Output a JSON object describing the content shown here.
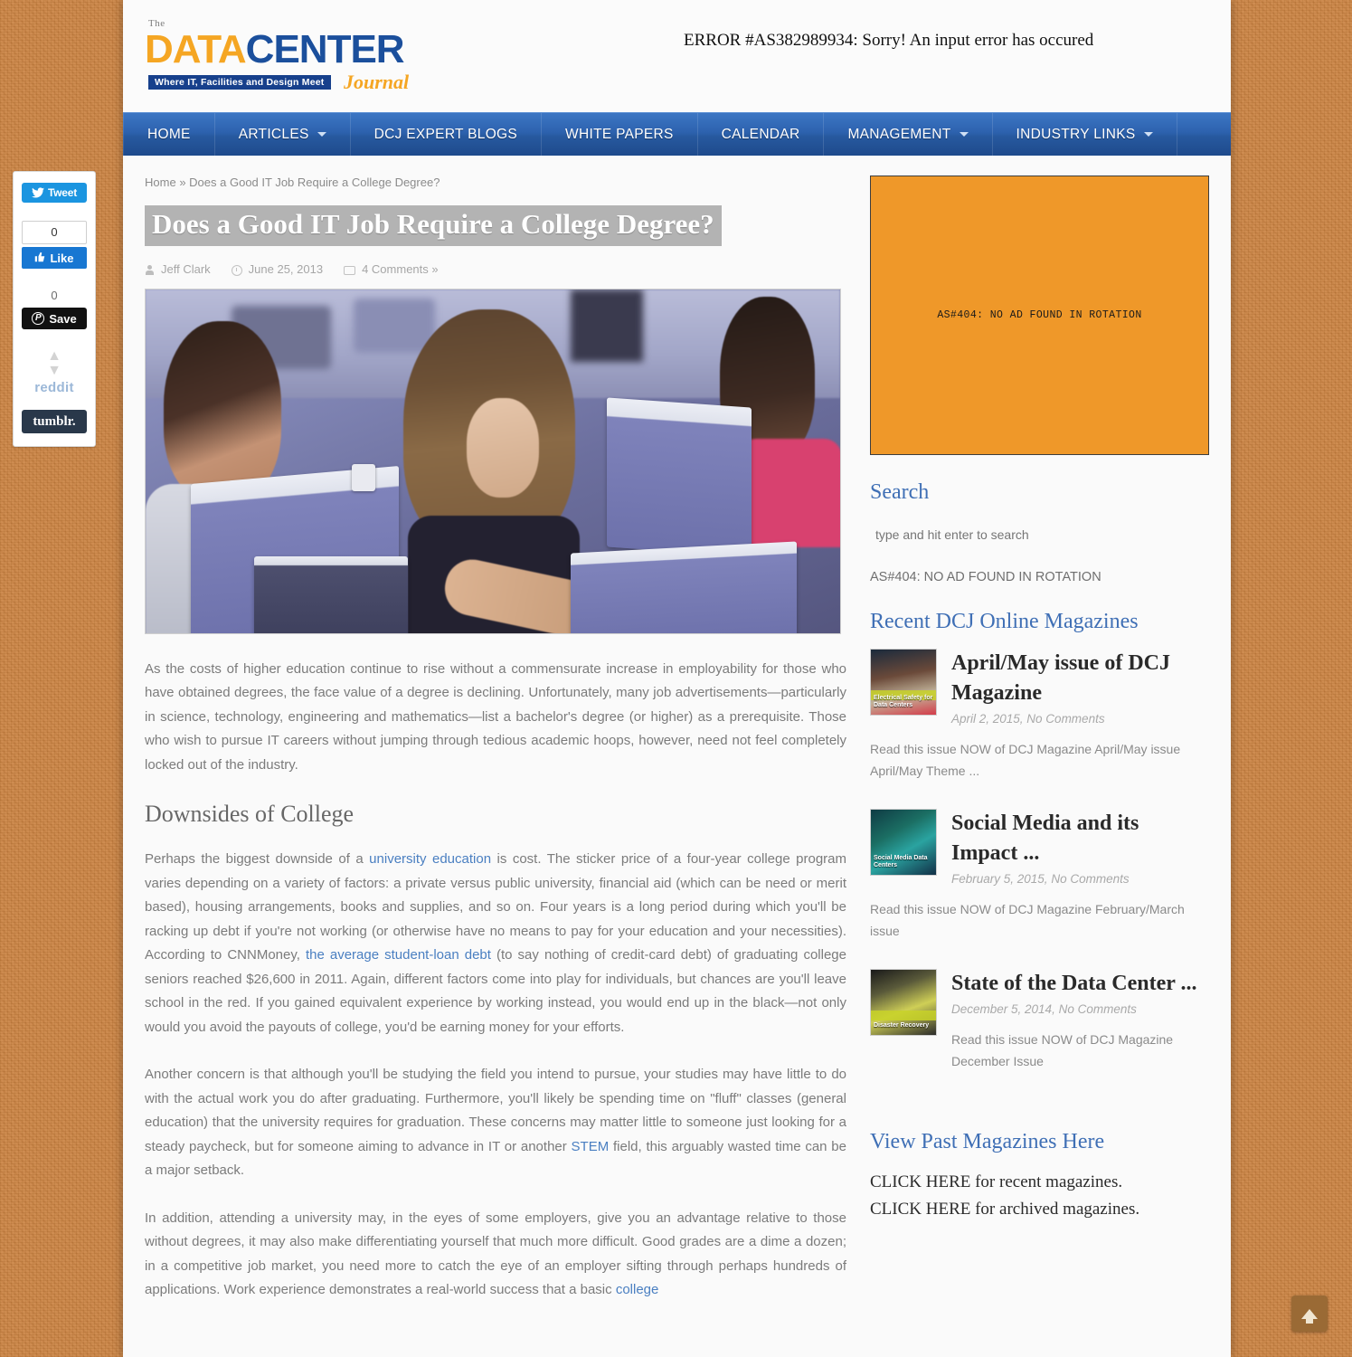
{
  "error_banner": "ERROR #AS382989934: Sorry! An input error has occured",
  "logo": {
    "the": "The",
    "data": "DATA",
    "center": "CENTER",
    "tagline": "Where IT, Facilities and Design Meet",
    "journal": "Journal"
  },
  "nav": {
    "items": [
      {
        "label": "HOME",
        "has_caret": false
      },
      {
        "label": "ARTICLES",
        "has_caret": true
      },
      {
        "label": "DCJ EXPERT BLOGS",
        "has_caret": false
      },
      {
        "label": "WHITE PAPERS",
        "has_caret": false
      },
      {
        "label": "CALENDAR",
        "has_caret": false
      },
      {
        "label": "MANAGEMENT",
        "has_caret": true
      },
      {
        "label": "INDUSTRY LINKS",
        "has_caret": true
      }
    ]
  },
  "breadcrumb": {
    "home": "Home",
    "separator": "»",
    "current": "Does a Good IT Job Require a College Degree?"
  },
  "post": {
    "title": "Does a Good IT Job Require a College Degree?",
    "author": "Jeff Clark",
    "date": "June 25, 2013",
    "comments": "4 Comments »",
    "paragraph_1": "As the costs of higher education continue to rise without a commensurate increase in employability for those who have obtained degrees, the face value of a degree is declining. Unfortunately, many job advertisements—particularly in science, technology, engineering and mathematics—list a bachelor's degree (or higher) as a prerequisite. Those who wish to pursue IT careers without jumping through tedious academic hoops, however, need not feel completely locked out of the industry.",
    "heading_1": "Downsides of College",
    "p2_a": "Perhaps the biggest downside of a ",
    "p2_link1": "university education",
    "p2_b": " is cost. The sticker price of a four-year college program varies depending on a variety of factors: a private versus public university, financial aid (which can be need or merit based), housing arrangements, books and supplies, and so on. Four years is a long period during which you'll be racking up debt if you're not working (or otherwise have no means to pay for your education and your necessities). According to CNNMoney, ",
    "p2_link2": "the average student-loan debt",
    "p2_c": " (to say nothing of credit-card debt) of graduating college seniors reached $26,600 in 2011. Again, different factors come into play for individuals, but chances are you'll leave school in the red. If you gained equivalent experience by working instead, you would end up in the black—not only would you avoid the payouts of college, you'd be earning money for your efforts.",
    "p3_a": "Another concern is that although you'll be studying the field you intend to pursue, your studies may have little to do with the actual work you do after graduating. Furthermore, you'll likely be spending time on \"fluff\" classes (general education) that the university requires for graduation. These concerns may matter little to someone just looking for a steady paycheck, but for someone aiming to advance in IT or another ",
    "p3_link": "STEM",
    "p3_b": " field, this arguably wasted time can be a major setback.",
    "p4_a": "In addition, attending a university may, in the eyes of some employers, give you an advantage relative to those without degrees, it may also make differentiating yourself that much more difficult. Good grades are a dime a dozen; in a competitive job market, you need more to catch the eye of an employer sifting through perhaps hundreds of applications. Work experience demonstrates a real-world success that a basic ",
    "p4_link": "college"
  },
  "social": {
    "tweet_label": "Tweet",
    "facebook_count": "0",
    "facebook_like": "Like",
    "pinterest_count": "0",
    "pinterest_label": "Save",
    "reddit_label": "reddit",
    "tumblr_label": "tumblr."
  },
  "sidebar": {
    "ad_text": "AS#404: NO AD FOUND IN ROTATION",
    "search_title": "Search",
    "search_placeholder": "type and hit enter to search",
    "search_value": "",
    "ad_note": "AS#404: NO AD FOUND IN ROTATION",
    "magazines_title": "Recent DCJ Online Magazines",
    "magazines": [
      {
        "title": "April/May issue of DCJ Magazine",
        "date": "April 2, 2015, No Comments",
        "excerpt": "Read this issue NOW of DCJ Magazine April/May issue April/May Theme ...",
        "cover_text": "Electrical Safety for Data Centers"
      },
      {
        "title": "Social Media and its Impact ...",
        "date": "February 5, 2015, No Comments",
        "excerpt": "Read this issue NOW of DCJ Magazine February/March issue",
        "cover_text": "Social Media Data Centers"
      },
      {
        "title": "State of the Data Center ...",
        "date": "December 5, 2014, No Comments",
        "excerpt": "Read this issue NOW of DCJ Magazine December Issue",
        "cover_text": "Disaster Recovery"
      }
    ],
    "past_magazines_title": "View Past Magazines Here",
    "cta_recent": "CLICK HERE for recent magazines.",
    "cta_archived": "CLICK HERE for archived magazines."
  },
  "colors": {
    "background": "#c8803f",
    "nav_blue": "#2d62ae",
    "accent_orange": "#f5a623",
    "link_blue": "#4a7fc1",
    "ad_orange": "#ef9829"
  }
}
